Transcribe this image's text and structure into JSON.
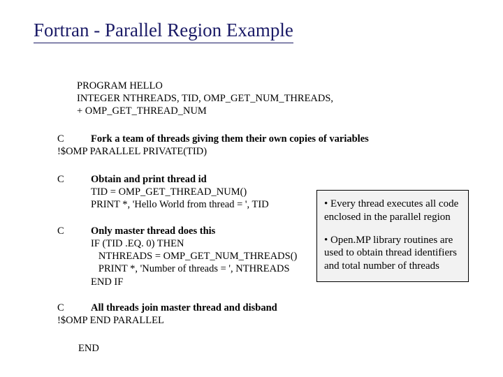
{
  "title": "Fortran - Parallel Region Example",
  "code": {
    "decl": "PROGRAM HELLO\nINTEGER NTHREADS, TID, OMP_GET_NUM_THREADS,\n+ OMP_GET_THREAD_NUM",
    "forkC": "C",
    "forkComment": "Fork a team of threads giving them their own copies of variables",
    "forkDirective": "!$OMP PARALLEL PRIVATE(TID)",
    "obtainC": "C",
    "obtainComment": "Obtain and print thread id",
    "obtainBody": "TID = OMP_GET_THREAD_NUM()\nPRINT *, 'Hello World from thread = ', TID",
    "masterC": "C",
    "masterComment": "Only master thread does this",
    "masterBody": "IF (TID .EQ. 0) THEN\n   NTHREADS = OMP_GET_NUM_THREADS()\n   PRINT *, 'Number of threads = ', NTHREADS\nEND IF",
    "joinC": "C",
    "joinComment": "All threads join master thread and disband",
    "joinDirective": "!$OMP END PARALLEL",
    "end": "END"
  },
  "box": {
    "point1": "• Every thread executes all code enclosed in the parallel region",
    "point2": "• Open.MP library routines are used to obtain thread identifiers and total number of threads"
  }
}
